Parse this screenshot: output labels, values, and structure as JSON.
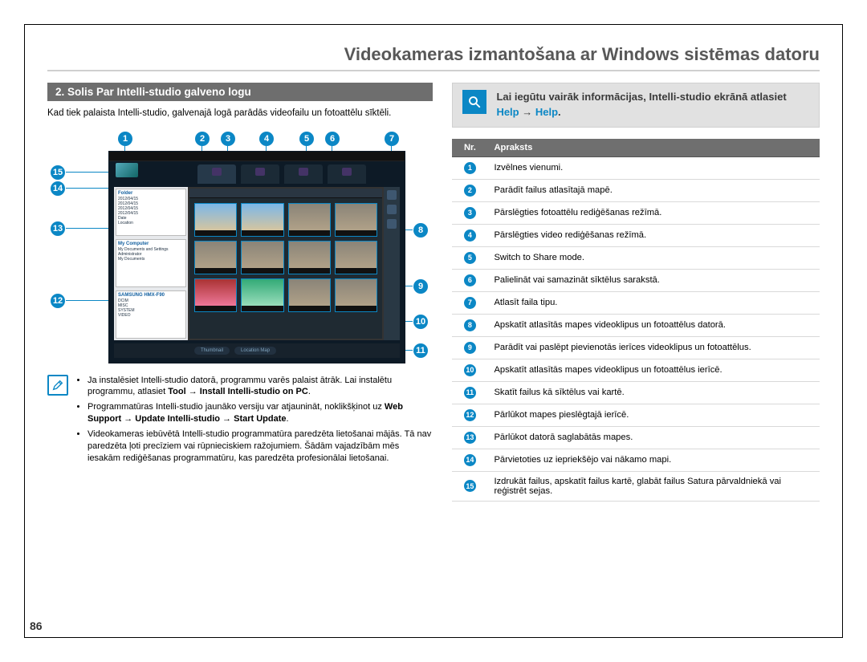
{
  "page_number": "86",
  "main_title": "Videokameras izmantošana ar Windows sistēmas datoru",
  "left": {
    "step_heading": "2. Solis Par Intelli-studio galveno logu",
    "intro": "Kad tiek palaista Intelli-studio, galvenajā logā parādās videofailu un fotoattēlu sīktēli.",
    "notes": [
      {
        "pre": "Ja instalēsiet Intelli-studio datorā, programmu varēs palaist ātrāk. Lai instalētu programmu, atlasiet ",
        "bold": "Tool → Install Intelli-studio on PC",
        "post": "."
      },
      {
        "pre": "Programmatūras Intelli-studio jaunāko versiju var atjaunināt, noklikšķinot uz ",
        "bold": "Web Support → Update Intelli-studio → Start Update",
        "post": "."
      },
      {
        "pre": "Videokameras iebūvētā Intelli-studio programmatūra paredzēta lietošanai mājās. Tā nav paredzēta ļoti precīziem vai rūpnieciskiem ražojumiem. Šādām vajadzībām mēs iesakām rediģēšanas programmatūru, kas paredzēta profesionālai lietošanai.",
        "bold": "",
        "post": ""
      }
    ]
  },
  "right": {
    "info_pre": "Lai iegūtu vairāk informācijas, Intelli-studio ekrānā atlasiet ",
    "info_help1": "Help",
    "info_arrow": " → ",
    "info_help2": "Help",
    "info_post": ".",
    "table": {
      "head_nr": "Nr.",
      "head_desc": "Apraksts",
      "rows": [
        {
          "n": "1",
          "d": "Izvēlnes vienumi."
        },
        {
          "n": "2",
          "d": "Parādīt failus atlasītajā mapē."
        },
        {
          "n": "3",
          "d": "Pārslēgties fotoattēlu rediģēšanas režīmā."
        },
        {
          "n": "4",
          "d": "Pārslēgties video rediģēšanas režīmā."
        },
        {
          "n": "5",
          "d": "Switch to Share mode."
        },
        {
          "n": "6",
          "d": "Palielināt vai samazināt sīktēlus sarakstā."
        },
        {
          "n": "7",
          "d": "Atlasīt faila tipu."
        },
        {
          "n": "8",
          "d": "Apskatīt atlasītās mapes videoklipus un fotoattēlus datorā."
        },
        {
          "n": "9",
          "d": "Parādīt vai paslēpt pievienotās ierīces videoklipus un fotoattēlus."
        },
        {
          "n": "10",
          "d": "Apskatīt atlasītās mapes videoklipus un fotoattēlus ierīcē."
        },
        {
          "n": "11",
          "d": "Skatīt failus kā sīktēlus vai kartē."
        },
        {
          "n": "12",
          "d": "Pārlūkot mapes pieslēgtajā ierīcē."
        },
        {
          "n": "13",
          "d": "Pārlūkot datorā saglabātās mapes."
        },
        {
          "n": "14",
          "d": "Pārvietoties uz iepriekšējo vai nākamo mapi."
        },
        {
          "n": "15",
          "d": "Izdrukāt failus, apskatīt failus kartē, glabāt failus Satura pārvaldniekā vai reģistrēt sejas."
        }
      ]
    }
  },
  "diagram": {
    "callouts_top": [
      "1",
      "2",
      "3",
      "4",
      "5",
      "6",
      "7"
    ],
    "callouts_left": [
      "15",
      "14",
      "13",
      "12"
    ],
    "callouts_right": [
      "8",
      "9",
      "10",
      "11"
    ],
    "sidebar_panel1_title": "Folder",
    "sidebar_panel1_lines": [
      "2012/04/15",
      "2012/04/15",
      "2012/04/15",
      "2012/04/15",
      "Date",
      "Location"
    ],
    "sidebar_panel2_title": "My Computer",
    "sidebar_panel2_lines": [
      "My Documents and Settings",
      "Administrator",
      "My Documents"
    ],
    "sidebar_panel3_title": "SAMSUNG HMX-F90",
    "sidebar_panel3_lines": [
      "DCIM",
      "MISC",
      "SYSTEM",
      "VIDEO"
    ],
    "footer_pill1": "Thumbnail",
    "footer_pill2": "Location Map"
  }
}
